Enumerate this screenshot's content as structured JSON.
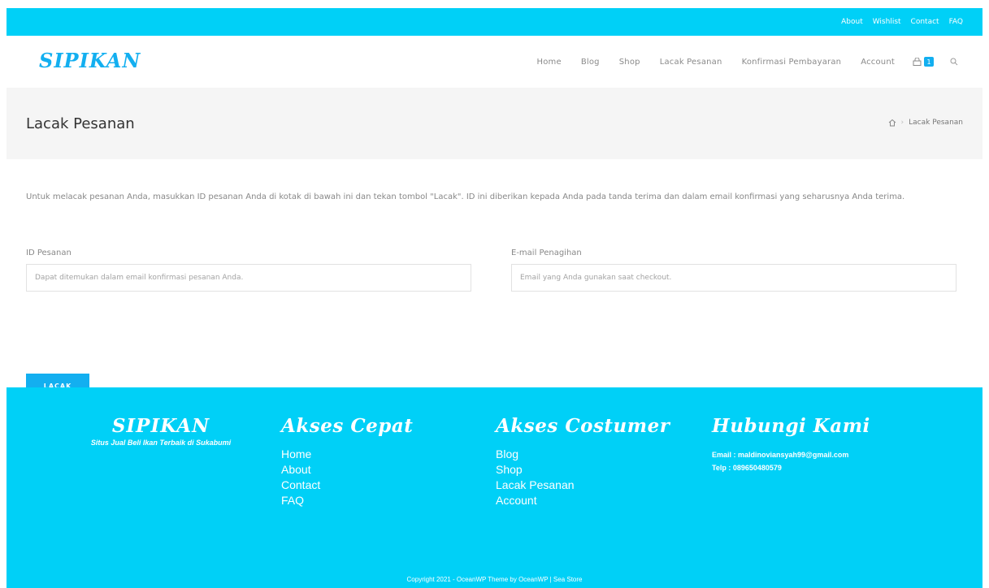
{
  "topbar": {
    "links": [
      "About",
      "Wishlist",
      "Contact",
      "FAQ"
    ]
  },
  "header": {
    "logo": "SIPIKAN",
    "nav": [
      "Home",
      "Blog",
      "Shop",
      "Lacak Pesanan",
      "Konfirmasi Pembayaran",
      "Account"
    ],
    "cart_count": "1"
  },
  "titlebar": {
    "title": "Lacak Pesanan",
    "breadcrumb_current": "Lacak Pesanan"
  },
  "content": {
    "intro": "Untuk melacak pesanan Anda, masukkan ID pesanan Anda di kotak di bawah ini dan tekan tombol \"Lacak\". ID ini diberikan kepada Anda pada tanda terima dan dalam email konfirmasi yang seharusnya Anda terima.",
    "order_id_label": "ID Pesanan",
    "order_id_placeholder": "Dapat ditemukan dalam email konfirmasi pesanan Anda.",
    "email_label": "E-mail Penagihan",
    "email_placeholder": "Email yang Anda gunakan saat checkout.",
    "button_label": "LACAK"
  },
  "footer": {
    "brand": "SIPIKAN",
    "tagline": "Situs Jual Beli Ikan Terbaik di Sukabumi",
    "quick_heading": "Akses Cepat",
    "quick_links": [
      "Home",
      "About",
      "Contact",
      "FAQ"
    ],
    "customer_heading": "Akses Costumer",
    "customer_links": [
      "Blog",
      "Shop",
      "Lacak Pesanan",
      "Account"
    ],
    "contact_heading": "Hubungi Kami",
    "email_line": "Email : maldinoviansyah99@gmail.com",
    "phone_line": "Telp : 089650480579",
    "copyright": "Copyright 2021 - OceanWP Theme by OceanWP | Sea Store"
  },
  "colors": {
    "accent": "#13aff0",
    "bar": "#00d0f7"
  },
  "icons": [
    "cart-icon",
    "search-icon",
    "home-icon"
  ]
}
